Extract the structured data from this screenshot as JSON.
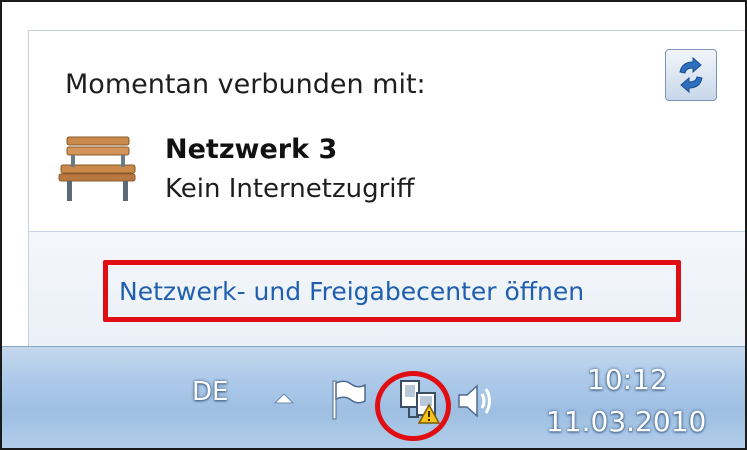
{
  "popup": {
    "connected_label": "Momentan verbunden mit:",
    "network_name": "Netzwerk 3",
    "network_status": "Kein Internetzugriff",
    "open_center_link": "Netzwerk- und Freigabecenter öffnen",
    "refresh_icon": "refresh-arrows-icon",
    "network_icon": "park-bench-icon"
  },
  "taskbar": {
    "language": "DE",
    "show_hidden_icon": "triangle-up-icon",
    "tray_icons": [
      "action-center-flag-icon",
      "network-warning-icon",
      "speaker-icon"
    ],
    "clock_time": "10:12",
    "clock_date": "11.03.2010"
  },
  "colors": {
    "highlight": "#e00d12",
    "link": "#1f5fae",
    "taskbar": "#aecaea"
  }
}
